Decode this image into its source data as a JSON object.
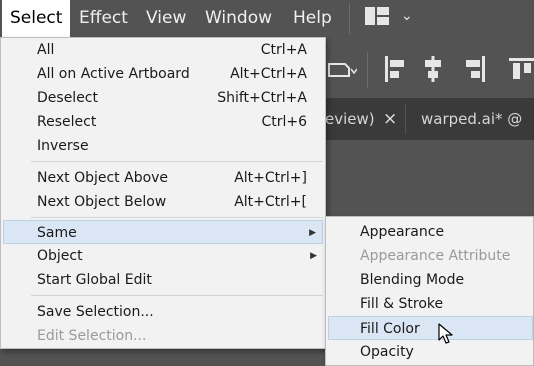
{
  "menubar": {
    "items": [
      "Select",
      "Effect",
      "View",
      "Window",
      "Help"
    ],
    "active": "Select"
  },
  "workspace": {
    "icon": "workspace-layout-icon",
    "chevron": "chevron-down-icon"
  },
  "toolbar": {
    "icons": [
      "shape-dropdown-icon",
      "align-left-icon",
      "align-center-icon",
      "align-right-icon",
      "align-top-icon"
    ]
  },
  "tabs": [
    {
      "label": "eview)",
      "close": "×"
    },
    {
      "label": "warped.ai* @"
    }
  ],
  "select_menu": {
    "groups": [
      [
        {
          "label": "All",
          "shortcut": "Ctrl+A"
        },
        {
          "label": "All on Active Artboard",
          "shortcut": "Alt+Ctrl+A"
        },
        {
          "label": "Deselect",
          "shortcut": "Shift+Ctrl+A"
        },
        {
          "label": "Reselect",
          "shortcut": "Ctrl+6"
        },
        {
          "label": "Inverse",
          "shortcut": ""
        }
      ],
      [
        {
          "label": "Next Object Above",
          "shortcut": "Alt+Ctrl+]"
        },
        {
          "label": "Next Object Below",
          "shortcut": "Alt+Ctrl+["
        }
      ],
      [
        {
          "label": "Same",
          "submenu": true,
          "highlighted": true
        },
        {
          "label": "Object",
          "submenu": true
        },
        {
          "label": "Start Global Edit"
        }
      ],
      [
        {
          "label": "Save Selection..."
        },
        {
          "label": "Edit Selection...",
          "disabled": true
        }
      ]
    ]
  },
  "same_submenu": {
    "items": [
      {
        "label": "Appearance"
      },
      {
        "label": "Appearance Attribute",
        "disabled": true
      },
      {
        "label": "Blending Mode"
      },
      {
        "label": "Fill & Stroke"
      },
      {
        "label": "Fill Color",
        "highlighted": true
      },
      {
        "label": "Opacity"
      }
    ]
  },
  "colors": {
    "chrome": "#535353",
    "menu_bg": "#f2f2f2",
    "highlight": "#dbe6f5",
    "disabled_text": "#9a9a9a"
  }
}
